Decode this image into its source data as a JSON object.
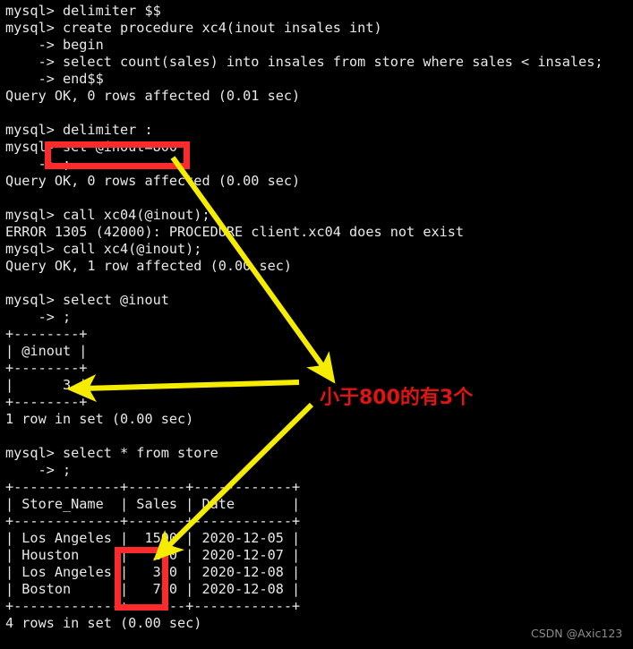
{
  "terminal": {
    "background_color": "#000000",
    "text_color": "#e8e8e8",
    "lines": [
      "mysql> delimiter $$",
      "mysql> create procedure xc4(inout insales int)",
      "    -> begin",
      "    -> select count(sales) into insales from store where sales < insales;",
      "    -> end$$",
      "Query OK, 0 rows affected (0.01 sec)",
      "",
      "mysql> delimiter :",
      "mysql> set @inout=800",
      "    -> ;",
      "Query OK, 0 rows affected (0.00 sec)",
      "",
      "mysql> call xc04(@inout);",
      "ERROR 1305 (42000): PROCEDURE client.xc04 does not exist",
      "mysql> call xc4(@inout);",
      "Query OK, 1 row affected (0.00 sec)",
      "",
      "mysql> select @inout",
      "    -> ;",
      "+--------+",
      "| @inout |",
      "+--------+",
      "|      3 |",
      "+--------+",
      "1 row in set (0.00 sec)",
      "",
      "mysql> select * from store",
      "    -> ;",
      "+-------------+-------+------------+",
      "| Store_Name  | Sales | Date       |",
      "+-------------+-------+------------+",
      "| Los Angeles |  1500 | 2020-12-05 |",
      "| Houston     |   250 | 2020-12-07 |",
      "| Los Angeles |   300 | 2020-12-08 |",
      "| Boston      |   700 | 2020-12-08 |",
      "+-------------+-------+------------+",
      "4 rows in set (0.00 sec)"
    ]
  },
  "query_result_inout": {
    "type": "table",
    "columns": [
      "@inout"
    ],
    "rows": [
      [
        "3"
      ]
    ],
    "footer": "1 row in set (0.00 sec)"
  },
  "query_result_store": {
    "type": "table",
    "columns": [
      "Store_Name",
      "Sales",
      "Date"
    ],
    "rows": [
      [
        "Los Angeles",
        "1500",
        "2020-12-05"
      ],
      [
        "Houston",
        "250",
        "2020-12-07"
      ],
      [
        "Los Angeles",
        "300",
        "2020-12-08"
      ],
      [
        "Boston",
        "700",
        "2020-12-08"
      ]
    ],
    "footer": "4 rows in set (0.00 sec)"
  },
  "annotations": {
    "highlight_color": "#fb2b2b",
    "arrow_color": "#f5ec00",
    "note_color": "#e01414",
    "note_text": "小于800的有3个",
    "boxes": [
      {
        "name": "set-statement-highlight",
        "target": "set @inout=800"
      },
      {
        "name": "sales-values-highlight",
        "target": "250 300 700"
      }
    ],
    "arrows": [
      {
        "name": "set-to-note-arrow",
        "from": "set @inout=800",
        "to": "小于800的有3个"
      },
      {
        "name": "note-to-result-arrow",
        "from": "小于800的有3个",
        "to": "3"
      },
      {
        "name": "note-to-sales-arrow",
        "from": "小于800的有3个",
        "to": "250 300 700"
      }
    ]
  },
  "watermark": {
    "text": "CSDN @Axic123"
  }
}
